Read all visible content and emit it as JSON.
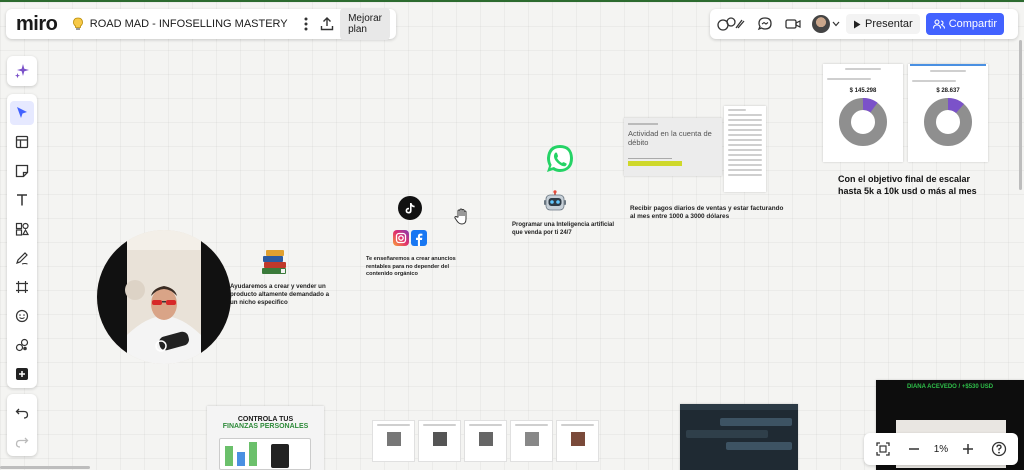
{
  "app": {
    "logo": "miro",
    "board_title": "ROAD MAD - INFOSELLING MASTERY",
    "upgrade_label": "Mejorar plan"
  },
  "header": {
    "present_label": "Presentar",
    "share_label": "Compartir"
  },
  "zoom": {
    "level": "1%"
  },
  "canvas": {
    "text_products": "Ayudaremos a crear y vender un producto altamente demandado a un nicho especifico",
    "text_ads": "Te enseñaremos a crear anuncios rentables para no depender del contenido orgánico",
    "text_ai": "Programar una Inteligencia artificial que venda por ti 24/7",
    "text_payments": "Recibir pagos diarios de ventas y estar facturando al mes entre 1000 a 3000 dólares",
    "text_goal": "Con el objetivo final de escalar hasta 5k a 10k usd o más al mes",
    "debit_card_title": "Actividad en la cuenta de débito",
    "stat1_value": "$ 145.298",
    "stat2_value": "$ 28.637",
    "finance_title_1": "CONTROLA TUS",
    "finance_title_2": "FINANZAS PERSONALES",
    "testimonial_header": "DIANA ACEVEDO / +$530 USD"
  },
  "colors": {
    "accent": "#4262ff",
    "donut_gray": "#8f8f8f",
    "donut_purple": "#7b52c9",
    "whatsapp": "#25d366",
    "hud_green": "#2f9e44"
  }
}
